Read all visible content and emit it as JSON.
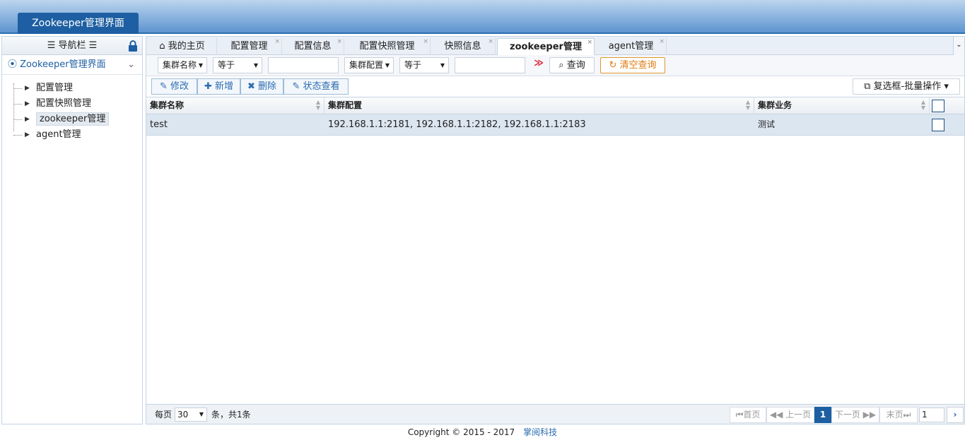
{
  "app": {
    "title": "Zookeeper管理界面"
  },
  "sidebar": {
    "header": "导航栏",
    "system": "Zookeeper管理界面",
    "items": [
      {
        "label": "配置管理"
      },
      {
        "label": "配置快照管理"
      },
      {
        "label": "zookeeper管理"
      },
      {
        "label": "agent管理"
      }
    ],
    "selected": "zookeeper管理"
  },
  "tabs": [
    {
      "label": "我的主页",
      "icon": "home-icon"
    },
    {
      "label": "配置管理"
    },
    {
      "label": "配置信息"
    },
    {
      "label": "配置快照管理"
    },
    {
      "label": "快照信息"
    },
    {
      "label": "zookeeper管理",
      "active": true
    },
    {
      "label": "agent管理"
    }
  ],
  "filter": {
    "field1": "集群名称",
    "op1": "等于",
    "value1": "",
    "field2": "集群配置",
    "op2": "等于",
    "value2": "",
    "search_label": "查询",
    "clear_label": "清空查询"
  },
  "toolbar": {
    "edit": "修改",
    "add": "新增",
    "delete": "删除",
    "status": "状态查看",
    "batch": "复选框-批量操作"
  },
  "grid": {
    "columns": [
      "集群名称",
      "集群配置",
      "集群业务"
    ],
    "rows": [
      {
        "name": "test",
        "config": "192.168.1.1:2181, 192.168.1.1:2182, 192.168.1.1:2183",
        "business": "测试"
      }
    ]
  },
  "pager": {
    "per_page_label": "每页",
    "per_page": "30",
    "total_text": "条，共1条",
    "first": "首页",
    "prev": "上一页",
    "current": "1",
    "next": "下一页",
    "last": "末页",
    "input": "1"
  },
  "footer": {
    "copyright": "Copyright © 2015 - 2017",
    "company": "掌阅科技"
  },
  "colors": {
    "accent": "#1d5fa2",
    "clear": "#e07b12",
    "more": "#d23"
  }
}
